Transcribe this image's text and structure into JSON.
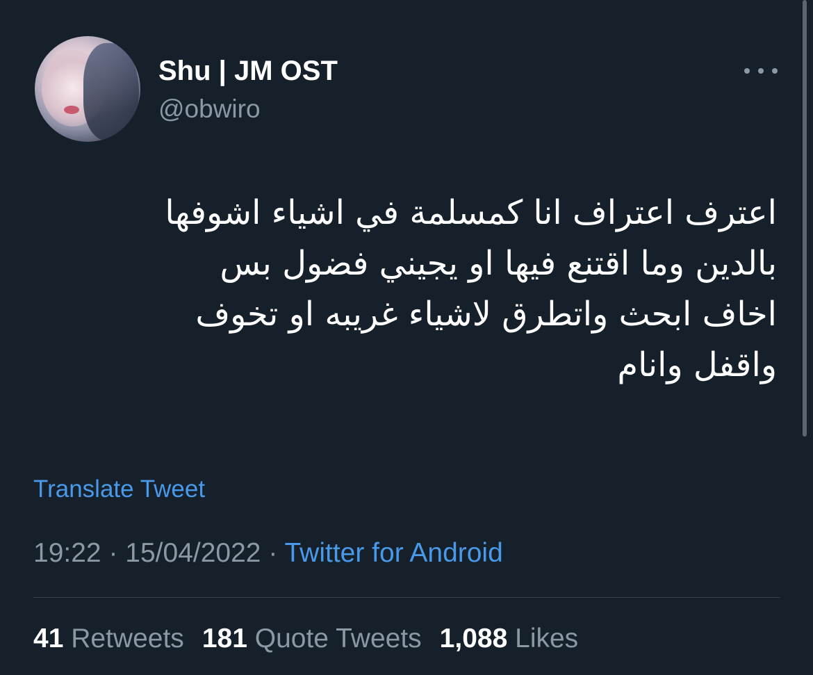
{
  "author": {
    "display_name": "Shu | JM OST",
    "handle": "@obwiro",
    "avatar_icon": "profile-photo"
  },
  "tweet": {
    "lines": [
      "اعترف اعتراف انا كمسلمة في اشياء اشوفها",
      "بالدين وما اقتنع فيها او يجيني فضول بس",
      "اخاف ابحث واتطرق لاشياء غريبه او تخوف",
      "واقفل وانام"
    ],
    "translate_label": "Translate Tweet",
    "time": "19:22",
    "separator": "·",
    "date": "15/04/2022",
    "source": "Twitter for Android"
  },
  "stats": {
    "retweets_count": "41",
    "retweets_label": "Retweets",
    "quotes_count": "181",
    "quotes_label": "Quote Tweets",
    "likes_count": "1,088",
    "likes_label": "Likes"
  },
  "colors": {
    "background": "#15202b",
    "secondary_text": "#8b98a5",
    "link": "#4a99e9",
    "divider": "#38444d"
  },
  "icons": {
    "more": "more-horizontal-icon"
  }
}
